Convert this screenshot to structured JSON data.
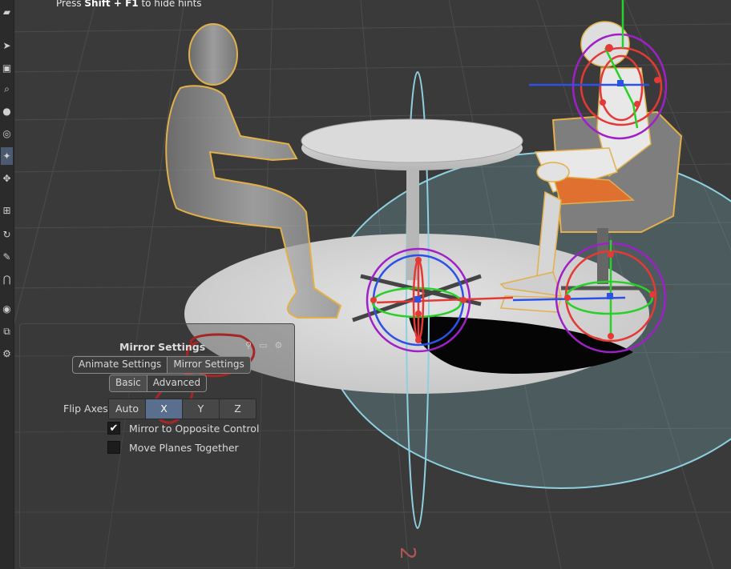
{
  "hint": {
    "prefix": "Press ",
    "keys": "Shift + F1",
    "suffix": " to hide hints"
  },
  "toolbar": {
    "tools": [
      {
        "name": "select-tool",
        "icon": "arrow-icon"
      },
      {
        "name": "lock-tool",
        "icon": "lock-icon"
      },
      {
        "name": "zoom-tool",
        "icon": "magnifier-icon"
      },
      {
        "name": "magnet-tool",
        "icon": "magnet-icon"
      },
      {
        "name": "camera-tool",
        "icon": "camera-icon"
      },
      {
        "name": "settings-tool",
        "icon": "gear-icon"
      }
    ]
  },
  "mirror_panel": {
    "title": "Mirror Settings",
    "mode_tabs": [
      "Animate Settings",
      "Mirror Settings"
    ],
    "level_tabs": [
      "Basic",
      "Advanced"
    ],
    "flip_axes": {
      "label": "Flip Axes",
      "options": [
        "Auto",
        "X",
        "Y",
        "Z"
      ],
      "selected": "X"
    },
    "mirror_to_opposite": {
      "label": "Mirror to Opposite Control",
      "checked": true,
      "mark": "✔"
    },
    "move_planes_together": {
      "label": "Move Planes Together",
      "checked": false
    }
  },
  "viewport": {
    "axis_marker": "2",
    "colors": {
      "background": "#3a3a3a",
      "grid": "#4a4a4a",
      "floor": "#d2d2d2",
      "sphere": "#8fd0e0",
      "outline": "#e2b04a",
      "handle_red": "#e53935",
      "handle_green": "#28d028",
      "handle_blue": "#2d50e6",
      "handle_purple": "#a020c8",
      "annotation": "#e01b1b"
    }
  }
}
